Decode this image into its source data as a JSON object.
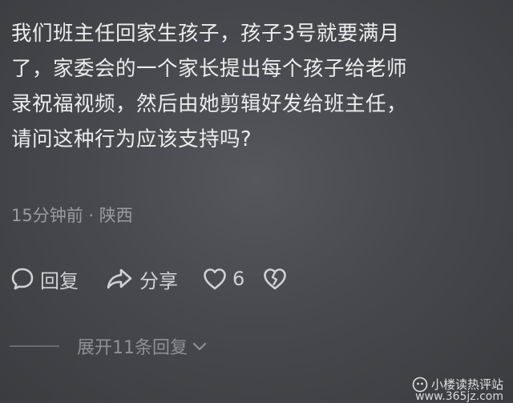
{
  "comment": {
    "lines": [
      "我们班主任回家生孩子，孩子3号就要满月",
      "了，家委会的一个家长提出每个孩子给老师",
      "录祝福视频，然后由她剪辑好发给班主任，",
      "请问这种行为应该支持吗?"
    ],
    "meta": "15分钟前 · 陕西"
  },
  "actions": {
    "reply_label": "回复",
    "share_label": "分享",
    "like_count": "6"
  },
  "replies": {
    "expand_label": "展开11条回复"
  },
  "watermark": {
    "name": "小楼读热评站",
    "url": "www.365jz.com"
  },
  "icons": {
    "reply": "speech-bubble-icon",
    "share": "share-arrow-icon",
    "like": "heart-icon",
    "dislike": "broken-heart-icon",
    "expand": "chevron-down-icon",
    "watermark": "watermark-logo-icon"
  },
  "colors": {
    "background": "#47494e",
    "body_text": "#ececec",
    "meta_text": "#9a9b9f",
    "action_text": "#d0d1d4",
    "expand_text": "#8f9095"
  }
}
